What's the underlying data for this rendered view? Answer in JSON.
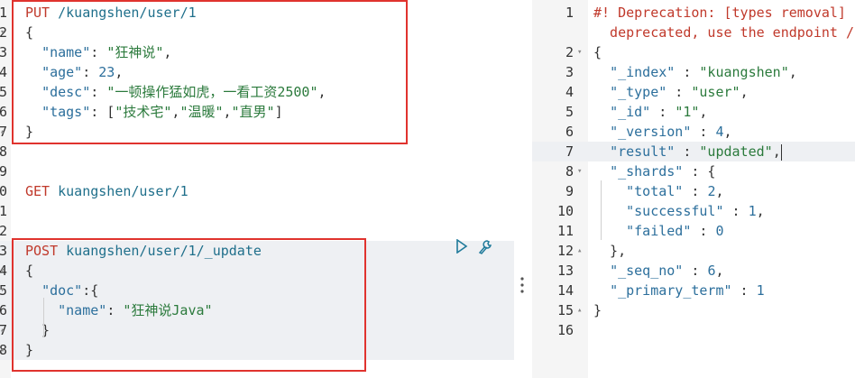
{
  "left_editor": {
    "lines": [
      {
        "n": "1",
        "fold": "",
        "html": [
          [
            "method",
            "PUT "
          ],
          [
            "url",
            "/kuangshen/user/1"
          ]
        ]
      },
      {
        "n": "2",
        "fold": "▾",
        "html": [
          [
            "pun",
            "{"
          ]
        ]
      },
      {
        "n": "3",
        "fold": "",
        "html": [
          [
            "pun",
            "  "
          ],
          [
            "key",
            "\"name\""
          ],
          [
            "pun",
            ": "
          ],
          [
            "str",
            "\"狂神说\""
          ],
          [
            "pun",
            ","
          ]
        ]
      },
      {
        "n": "4",
        "fold": "",
        "html": [
          [
            "pun",
            "  "
          ],
          [
            "key",
            "\"age\""
          ],
          [
            "pun",
            ": "
          ],
          [
            "num",
            "23"
          ],
          [
            "pun",
            ","
          ]
        ]
      },
      {
        "n": "5",
        "fold": "",
        "html": [
          [
            "pun",
            "  "
          ],
          [
            "key",
            "\"desc\""
          ],
          [
            "pun",
            ": "
          ],
          [
            "str",
            "\"一顿操作猛如虎，一看工资2500\""
          ],
          [
            "pun",
            ","
          ]
        ]
      },
      {
        "n": "6",
        "fold": "",
        "html": [
          [
            "pun",
            "  "
          ],
          [
            "key",
            "\"tags\""
          ],
          [
            "pun",
            ": ["
          ],
          [
            "str",
            "\"技术宅\""
          ],
          [
            "pun",
            ","
          ],
          [
            "str",
            "\"温暖\""
          ],
          [
            "pun",
            ","
          ],
          [
            "str",
            "\"直男\""
          ],
          [
            "pun",
            "]"
          ]
        ]
      },
      {
        "n": "7",
        "fold": "▴",
        "html": [
          [
            "pun",
            "}"
          ]
        ]
      },
      {
        "n": "8",
        "fold": "",
        "html": []
      },
      {
        "n": "9",
        "fold": "",
        "html": []
      },
      {
        "n": "0",
        "fold": "",
        "html": [
          [
            "method",
            "GET "
          ],
          [
            "url",
            "kuangshen/user/1"
          ]
        ]
      },
      {
        "n": "1",
        "fold": "",
        "html": []
      },
      {
        "n": "2",
        "fold": "",
        "html": []
      },
      {
        "n": "3",
        "fold": "",
        "html": [
          [
            "method",
            "POST "
          ],
          [
            "url",
            "kuangshen/user/1/_update"
          ]
        ],
        "hl": true
      },
      {
        "n": "4",
        "fold": "▾",
        "html": [
          [
            "pun",
            "{"
          ]
        ],
        "hl": true
      },
      {
        "n": "5",
        "fold": "▾",
        "html": [
          [
            "pun",
            "  "
          ],
          [
            "key",
            "\"doc\""
          ],
          [
            "pun",
            ":{"
          ]
        ],
        "hl": true
      },
      {
        "n": "6",
        "fold": "",
        "html": [
          [
            "pun",
            "    "
          ],
          [
            "key",
            "\"name\""
          ],
          [
            "pun",
            ": "
          ],
          [
            "str",
            "\"狂神说Java\""
          ]
        ],
        "hl": true
      },
      {
        "n": "7",
        "fold": "▴",
        "html": [
          [
            "pun",
            "  }"
          ]
        ],
        "hl": true
      },
      {
        "n": "8",
        "fold": "▴",
        "html": [
          [
            "pun",
            "}"
          ]
        ],
        "hl": true
      }
    ],
    "run_icon": "play-icon",
    "wrench_icon": "wrench-icon"
  },
  "right_editor": {
    "lines": [
      {
        "n": "1",
        "fold": "",
        "html": [
          [
            "cmt",
            "#! Deprecation: [types removal] Specifying types in document update requests is"
          ]
        ]
      },
      {
        "n": "",
        "fold": "",
        "html": [
          [
            "cmt",
            "  deprecated, use the endpoint /{index}/_update/{id} instead."
          ]
        ]
      },
      {
        "n": "2",
        "fold": "▾",
        "html": [
          [
            "pun",
            "{"
          ]
        ]
      },
      {
        "n": "3",
        "fold": "",
        "html": [
          [
            "pun",
            "  "
          ],
          [
            "key",
            "\"_index\""
          ],
          [
            "pun",
            " : "
          ],
          [
            "str",
            "\"kuangshen\""
          ],
          [
            "pun",
            ","
          ]
        ]
      },
      {
        "n": "4",
        "fold": "",
        "html": [
          [
            "pun",
            "  "
          ],
          [
            "key",
            "\"_type\""
          ],
          [
            "pun",
            " : "
          ],
          [
            "str",
            "\"user\""
          ],
          [
            "pun",
            ","
          ]
        ]
      },
      {
        "n": "5",
        "fold": "",
        "html": [
          [
            "pun",
            "  "
          ],
          [
            "key",
            "\"_id\""
          ],
          [
            "pun",
            " : "
          ],
          [
            "str",
            "\"1\""
          ],
          [
            "pun",
            ","
          ]
        ]
      },
      {
        "n": "6",
        "fold": "",
        "html": [
          [
            "pun",
            "  "
          ],
          [
            "key",
            "\"_version\""
          ],
          [
            "pun",
            " : "
          ],
          [
            "num",
            "4"
          ],
          [
            "pun",
            ","
          ]
        ]
      },
      {
        "n": "7",
        "fold": "",
        "html": [
          [
            "pun",
            "  "
          ],
          [
            "key",
            "\"result\""
          ],
          [
            "pun",
            " : "
          ],
          [
            "str",
            "\"updated\""
          ],
          [
            "pun",
            ","
          ]
        ],
        "hl": true,
        "cursor": true
      },
      {
        "n": "8",
        "fold": "▾",
        "html": [
          [
            "pun",
            "  "
          ],
          [
            "key",
            "\"_shards\""
          ],
          [
            "pun",
            " : {"
          ]
        ]
      },
      {
        "n": "9",
        "fold": "",
        "html": [
          [
            "pun",
            "    "
          ],
          [
            "key",
            "\"total\""
          ],
          [
            "pun",
            " : "
          ],
          [
            "num",
            "2"
          ],
          [
            "pun",
            ","
          ]
        ]
      },
      {
        "n": "10",
        "fold": "",
        "html": [
          [
            "pun",
            "    "
          ],
          [
            "key",
            "\"successful\""
          ],
          [
            "pun",
            " : "
          ],
          [
            "num",
            "1"
          ],
          [
            "pun",
            ","
          ]
        ]
      },
      {
        "n": "11",
        "fold": "",
        "html": [
          [
            "pun",
            "    "
          ],
          [
            "key",
            "\"failed\""
          ],
          [
            "pun",
            " : "
          ],
          [
            "num",
            "0"
          ]
        ]
      },
      {
        "n": "12",
        "fold": "▴",
        "html": [
          [
            "pun",
            "  },"
          ]
        ]
      },
      {
        "n": "13",
        "fold": "",
        "html": [
          [
            "pun",
            "  "
          ],
          [
            "key",
            "\"_seq_no\""
          ],
          [
            "pun",
            " : "
          ],
          [
            "num",
            "6"
          ],
          [
            "pun",
            ","
          ]
        ]
      },
      {
        "n": "14",
        "fold": "",
        "html": [
          [
            "pun",
            "  "
          ],
          [
            "key",
            "\"_primary_term\""
          ],
          [
            "pun",
            " : "
          ],
          [
            "num",
            "1"
          ]
        ]
      },
      {
        "n": "15",
        "fold": "▴",
        "html": [
          [
            "pun",
            "}"
          ]
        ]
      },
      {
        "n": "16",
        "fold": "",
        "html": []
      }
    ]
  },
  "splitter": {
    "icon": "vertical-dots-icon",
    "glyph": "⋮"
  },
  "colors": {
    "highlight_box": "#e0332e",
    "method": "#c0392b",
    "url": "#1f6f8b",
    "string": "#2b7a3c"
  }
}
